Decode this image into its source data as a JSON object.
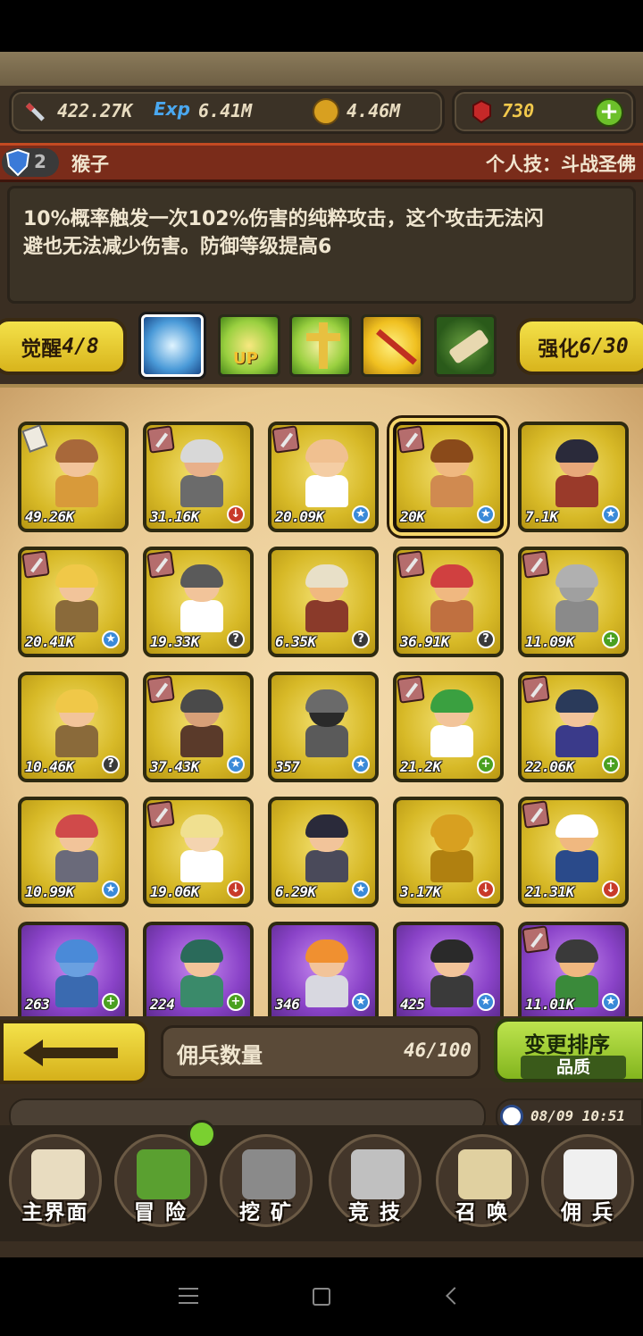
{
  "resources": {
    "attack": "422.27K",
    "exp_label": "Exp",
    "exp": "6.41M",
    "gold": "4.46M",
    "gems": "730"
  },
  "hero": {
    "level_badge": "2",
    "name": "猴子",
    "skill_label": "个人技：斗战圣佛",
    "description_line1": "10%概率触发一次102%伤害的纯粹攻击，这个攻击无法闪",
    "description_line2": "避也无法减少伤害。防御等级提高6"
  },
  "awaken": {
    "label": "觉醒",
    "value": "4/8"
  },
  "enhance": {
    "label": "强化",
    "value": "6/30"
  },
  "skill_icons": [
    "lightning-icon",
    "crown-up-icon",
    "cross-handshake-icon",
    "staff-icon",
    "scroll-icon"
  ],
  "mercenaries": [
    {
      "value": "49.26K",
      "badge": "",
      "tag": "paper",
      "hair": "#a8683a",
      "skin": "#f2c49a",
      "body": "#d89a3a"
    },
    {
      "value": "31.16K",
      "badge": "down",
      "tag": "sword",
      "hair": "#d8d8d8",
      "skin": "#e8b08a",
      "body": "#6b6b6b"
    },
    {
      "value": "20.09K",
      "badge": "star",
      "tag": "sword",
      "hair": "#f0c090",
      "skin": "#f4cda4",
      "body": "#ffffff"
    },
    {
      "value": "20K",
      "badge": "star",
      "tag": "sword",
      "hair": "#8a4a1a",
      "skin": "#f0b880",
      "body": "#d08a50"
    },
    {
      "value": "7.1K",
      "badge": "star",
      "tag": "",
      "hair": "#2a2a3a",
      "skin": "#e8a87a",
      "body": "#9a3a2a"
    },
    {
      "value": "20.41K",
      "badge": "star",
      "tag": "sword",
      "hair": "#f0c848",
      "skin": "#f2c49a",
      "body": "#8a6a3a"
    },
    {
      "value": "19.33K",
      "badge": "q",
      "tag": "sword",
      "hair": "#5a5a5a",
      "skin": "#f2c49a",
      "body": "#ffffff"
    },
    {
      "value": "6.35K",
      "badge": "q",
      "tag": "",
      "hair": "#e8e0c8",
      "skin": "#f0b880",
      "body": "#8a3a2a"
    },
    {
      "value": "36.91K",
      "badge": "q",
      "tag": "sword",
      "hair": "#d04040",
      "skin": "#f0b880",
      "body": "#c07040"
    },
    {
      "value": "11.09K",
      "badge": "plus",
      "tag": "sword",
      "hair": "#b0b0b0",
      "skin": "#a0a0a0",
      "body": "#8a8a8a"
    },
    {
      "value": "10.46K",
      "badge": "q",
      "tag": "",
      "hair": "#f0c848",
      "skin": "#f2c49a",
      "body": "#8a6a3a"
    },
    {
      "value": "37.43K",
      "badge": "star",
      "tag": "sword",
      "hair": "#4a4a4a",
      "skin": "#d8a078",
      "body": "#5a3a2a"
    },
    {
      "value": "357",
      "badge": "star",
      "tag": "",
      "hair": "#6a6a6a",
      "skin": "#2a2a2a",
      "body": "#5a5a5a"
    },
    {
      "value": "21.2K",
      "badge": "plus",
      "tag": "sword",
      "hair": "#3aa040",
      "skin": "#f2c49a",
      "body": "#ffffff"
    },
    {
      "value": "22.06K",
      "badge": "plus",
      "tag": "sword",
      "hair": "#2a3a5a",
      "skin": "#f2c49a",
      "body": "#3a3a8a"
    },
    {
      "value": "10.99K",
      "badge": "star",
      "tag": "",
      "hair": "#d04a4a",
      "skin": "#f2c49a",
      "body": "#6a6a7a"
    },
    {
      "value": "19.06K",
      "badge": "down",
      "tag": "sword",
      "hair": "#f0e090",
      "skin": "#f4d4b0",
      "body": "#ffffff"
    },
    {
      "value": "6.29K",
      "badge": "star",
      "tag": "",
      "hair": "#2a2a3a",
      "skin": "#f2c49a",
      "body": "#4a4a5a"
    },
    {
      "value": "3.17K",
      "badge": "down",
      "tag": "",
      "hair": "#d8a020",
      "skin": "#d8a020",
      "body": "#b08010"
    },
    {
      "value": "21.31K",
      "badge": "down",
      "tag": "sword",
      "hair": "#ffffff",
      "skin": "#f0b880",
      "body": "#2a4a8a"
    },
    {
      "value": "263",
      "badge": "plus",
      "tag": "",
      "hair": "#4a8ad8",
      "skin": "#6aa0e0",
      "body": "#3a6ab0",
      "purple": true
    },
    {
      "value": "224",
      "badge": "plus",
      "tag": "",
      "hair": "#2a6a5a",
      "skin": "#f2c49a",
      "body": "#3a8a6a",
      "purple": true
    },
    {
      "value": "346",
      "badge": "star",
      "tag": "",
      "hair": "#f09030",
      "skin": "#f2c49a",
      "body": "#d8d8e0",
      "purple": true
    },
    {
      "value": "425",
      "badge": "star",
      "tag": "",
      "hair": "#2a2a2a",
      "skin": "#f2c49a",
      "body": "#3a3a3a",
      "purple": true
    },
    {
      "value": "11.01K",
      "badge": "star",
      "tag": "sword",
      "hair": "#3a3a3a",
      "skin": "#f0b880",
      "body": "#3a8a3a",
      "purple": true
    }
  ],
  "selected_index": 3,
  "count": {
    "label": "佣兵数量",
    "value": "46/100"
  },
  "sort": {
    "label": "变更排序",
    "sub": "品质"
  },
  "datetime": "08/09 10:51",
  "nav": [
    {
      "label": "主界面",
      "icon": "map-scroll-icon"
    },
    {
      "label": "冒 险",
      "icon": "island-icon"
    },
    {
      "label": "挖 矿",
      "icon": "pickaxe-icon"
    },
    {
      "label": "竞 技",
      "icon": "crossed-swords-icon"
    },
    {
      "label": "召 唤",
      "icon": "summon-scroll-icon"
    },
    {
      "label": "佣 兵",
      "icon": "tent-icon"
    }
  ],
  "colors": {
    "accent_yellow": "#f4e24a",
    "accent_green": "#9ccb2c",
    "name_bar": "#7a2c1a",
    "gem": "#c62828"
  }
}
